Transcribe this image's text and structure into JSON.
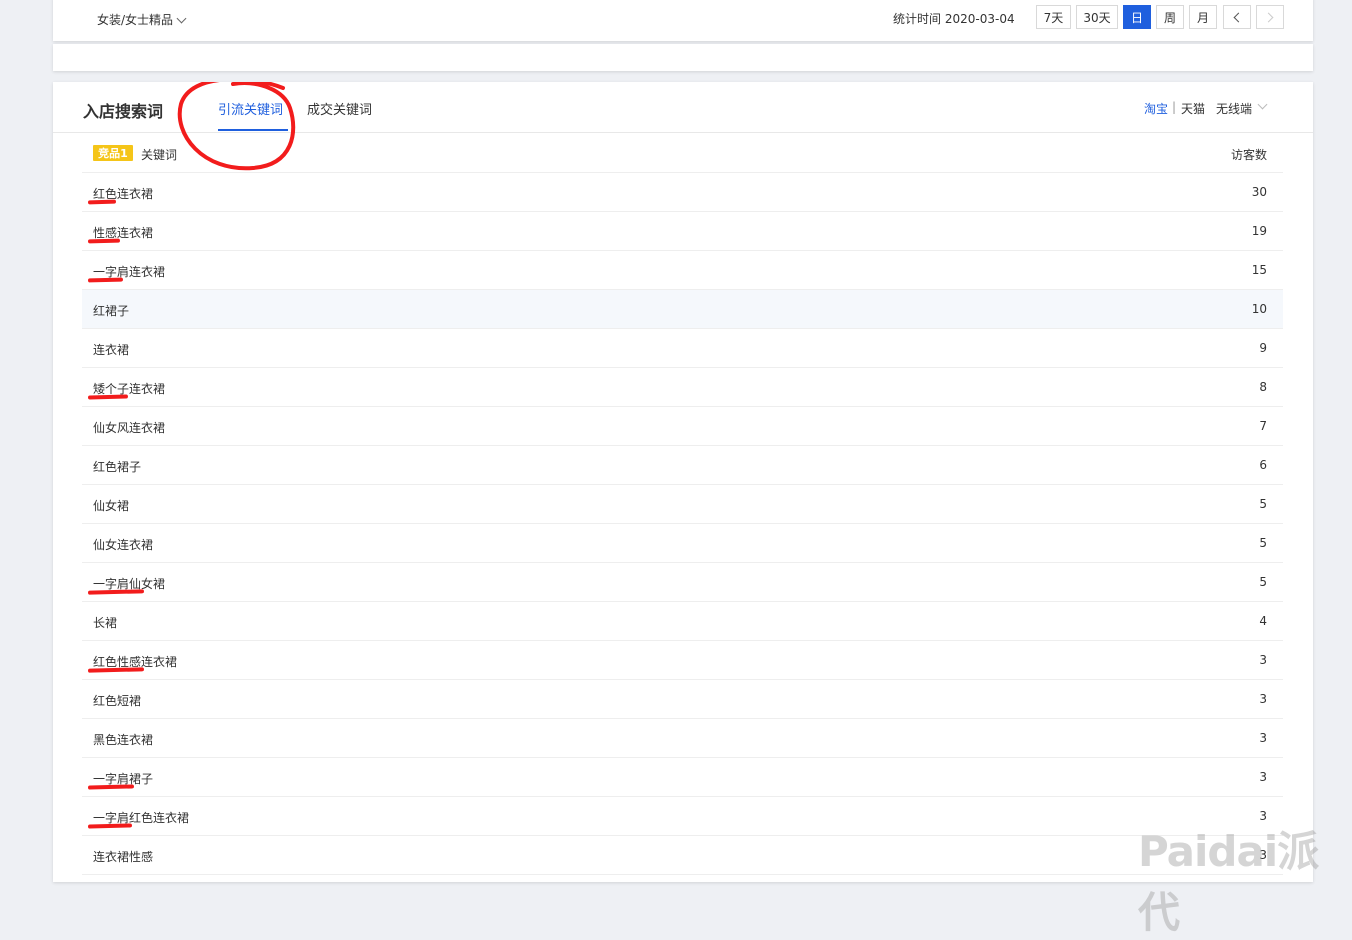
{
  "filters": {
    "category": "女装/女士精品",
    "stat_label": "统计时间",
    "stat_date": "2020-03-04",
    "periods": [
      "7天",
      "30天",
      "日",
      "周",
      "月"
    ],
    "active_period": "日"
  },
  "section": {
    "title": "入店搜索词",
    "tabs": [
      {
        "label": "引流关键词",
        "active": true
      },
      {
        "label": "成交关键词",
        "active": false
      }
    ],
    "platforms": [
      {
        "label": "淘宝",
        "active": true
      },
      {
        "label": "天猫",
        "active": false
      }
    ],
    "platform_separator": "|",
    "device": "无线端"
  },
  "table": {
    "badge": "竞品1",
    "col_keyword": "关键词",
    "col_visitors": "访客数",
    "rows": [
      {
        "keyword": "红色连衣裙",
        "visitors": "30",
        "marked": true
      },
      {
        "keyword": "性感连衣裙",
        "visitors": "19",
        "marked": true
      },
      {
        "keyword": "一字肩连衣裙",
        "visitors": "15",
        "marked": true
      },
      {
        "keyword": "红裙子",
        "visitors": "10",
        "marked": false
      },
      {
        "keyword": "连衣裙",
        "visitors": "9",
        "marked": false
      },
      {
        "keyword": "矮个子连衣裙",
        "visitors": "8",
        "marked": true
      },
      {
        "keyword": "仙女风连衣裙",
        "visitors": "7",
        "marked": false
      },
      {
        "keyword": "红色裙子",
        "visitors": "6",
        "marked": false
      },
      {
        "keyword": "仙女裙",
        "visitors": "5",
        "marked": false
      },
      {
        "keyword": "仙女连衣裙",
        "visitors": "5",
        "marked": false
      },
      {
        "keyword": "一字肩仙女裙",
        "visitors": "5",
        "marked": true
      },
      {
        "keyword": "长裙",
        "visitors": "4",
        "marked": false
      },
      {
        "keyword": "红色性感连衣裙",
        "visitors": "3",
        "marked": true
      },
      {
        "keyword": "红色短裙",
        "visitors": "3",
        "marked": false
      },
      {
        "keyword": "黑色连衣裙",
        "visitors": "3",
        "marked": false
      },
      {
        "keyword": "一字肩裙子",
        "visitors": "3",
        "marked": true
      },
      {
        "keyword": "一字肩红色连衣裙",
        "visitors": "3",
        "marked": true
      },
      {
        "keyword": "连衣裙性感",
        "visitors": "3",
        "marked": false
      }
    ]
  },
  "watermark": "Paidai派代",
  "colors": {
    "accent": "#1f5fde",
    "badge": "#f5c518",
    "annotation": "#f21c1c"
  }
}
